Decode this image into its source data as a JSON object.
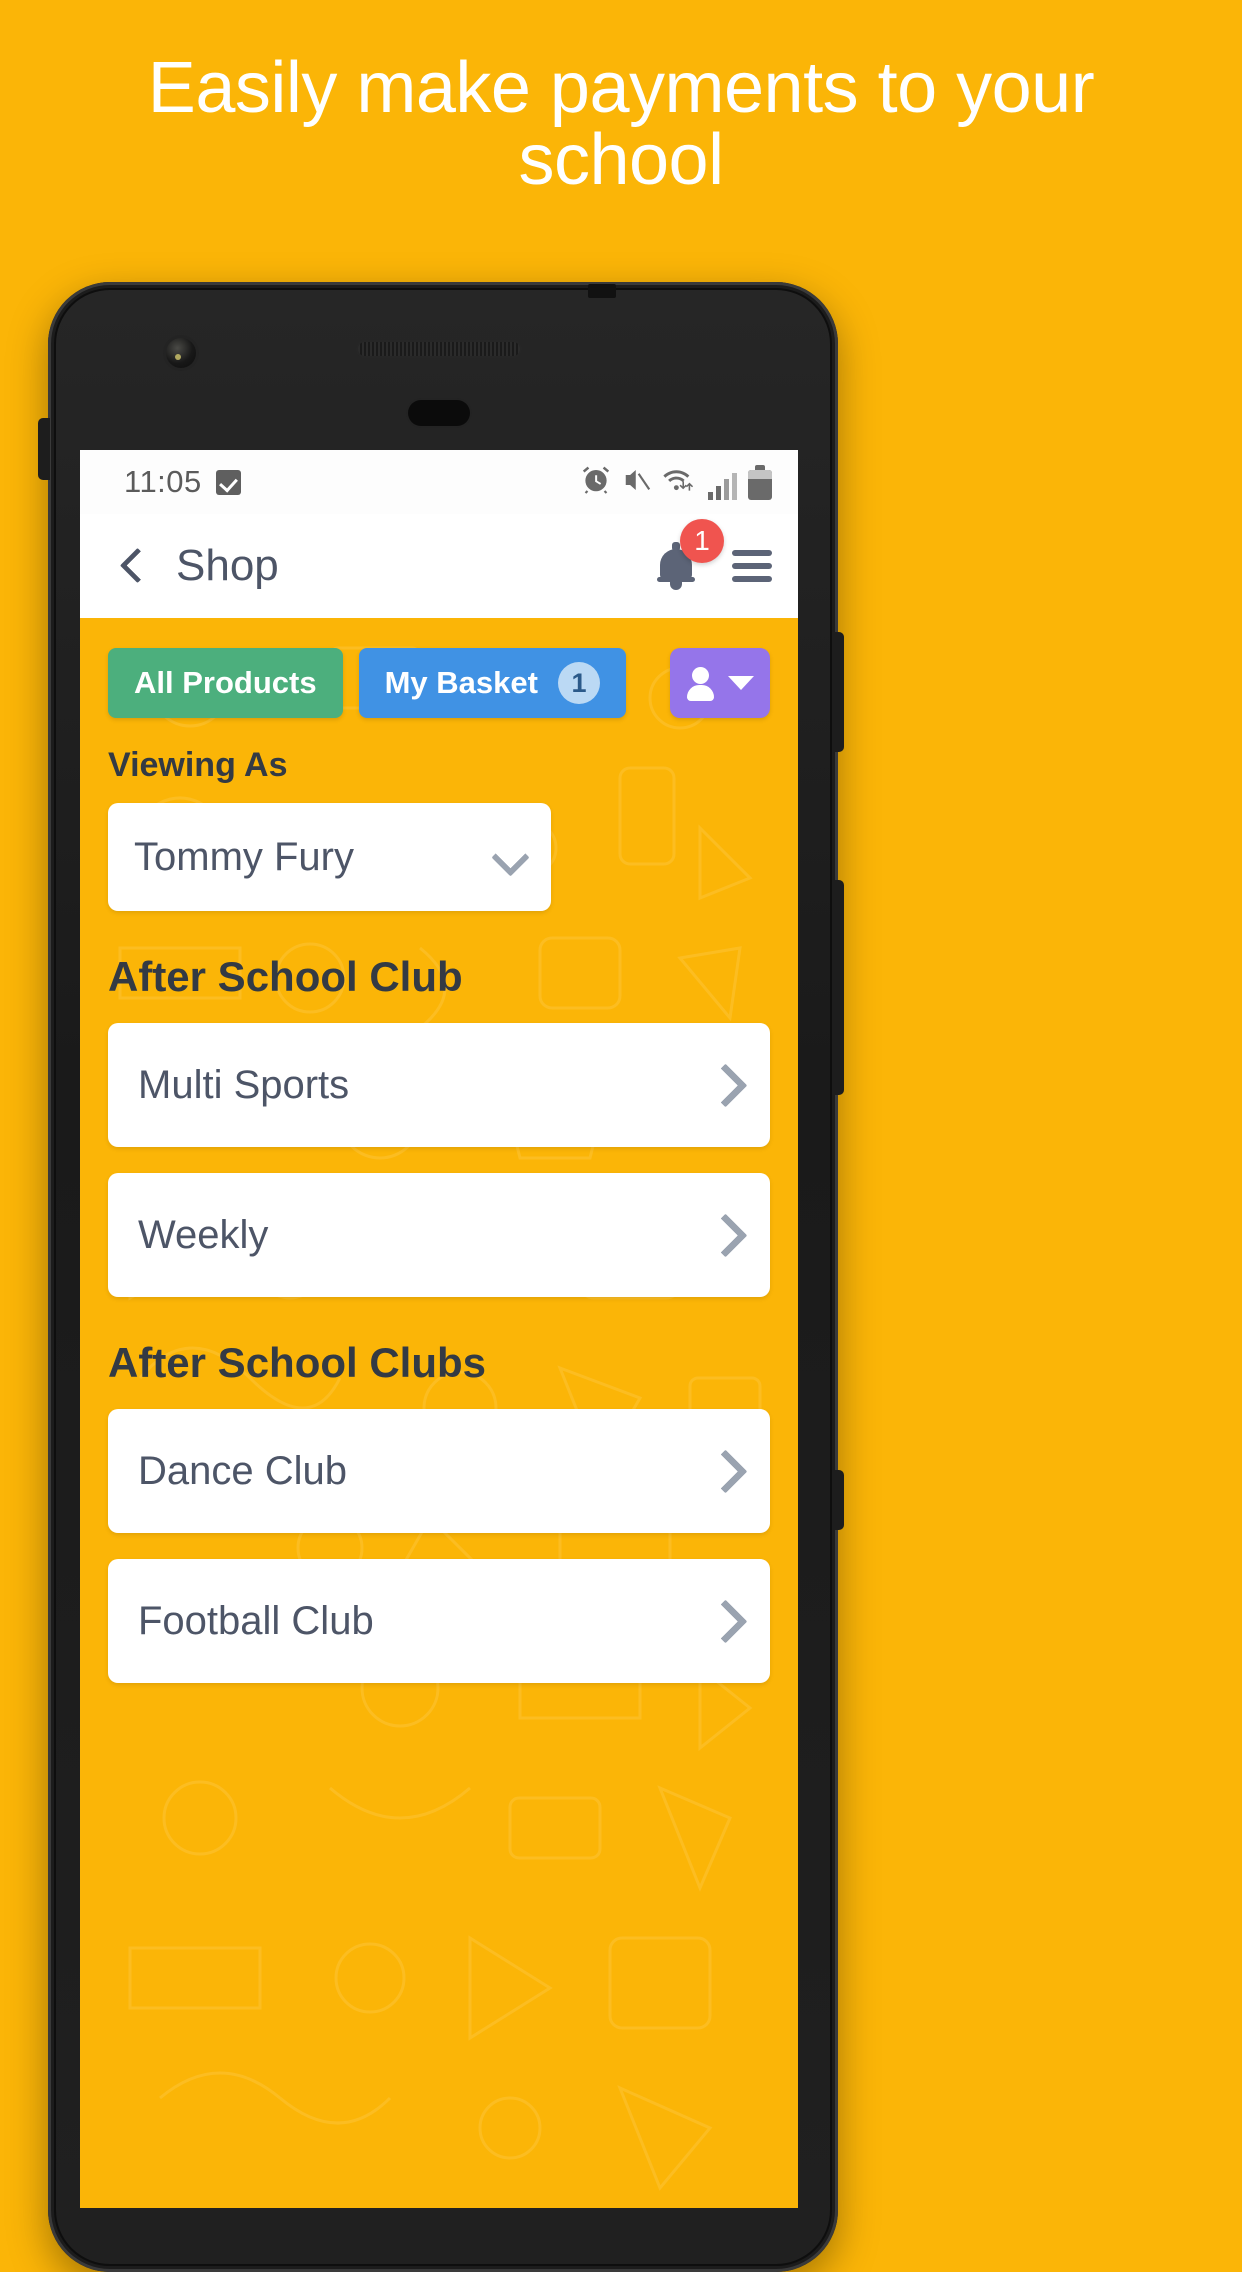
{
  "promo": {
    "headline": "Easily make payments to your school"
  },
  "colors": {
    "background": "#FBB507",
    "accent_green": "#4CAF7D",
    "accent_blue": "#4092E4",
    "accent_purple": "#9575EA",
    "badge_red": "#F0544F",
    "text_dark": "#333A44",
    "text_muted": "#4D5567"
  },
  "status_bar": {
    "time": "11:05",
    "icons": [
      "checkbox-icon",
      "alarm-clock-icon",
      "volume-mute-icon",
      "wifi-icon",
      "signal-bars-icon",
      "battery-icon"
    ]
  },
  "app_bar": {
    "back_icon": "chevron-left-icon",
    "title": "Shop",
    "notification_icon": "bell-icon",
    "notification_count": "1",
    "menu_icon": "hamburger-menu-icon"
  },
  "tabs": [
    {
      "label": "All Products",
      "badge": null
    },
    {
      "label": "My Basket",
      "badge": "1"
    }
  ],
  "user_button": {
    "icon": "person-icon",
    "caret": "caret-down-icon"
  },
  "viewing_as": {
    "label": "Viewing As",
    "selected": "Tommy Fury",
    "chevron": "chevron-down-icon"
  },
  "sections": [
    {
      "title": "After School Club",
      "items": [
        {
          "label": "Multi Sports",
          "chevron": "chevron-right-icon"
        },
        {
          "label": "Weekly",
          "chevron": "chevron-right-icon"
        }
      ]
    },
    {
      "title": "After School Clubs",
      "items": [
        {
          "label": "Dance Club",
          "chevron": "chevron-right-icon"
        },
        {
          "label": "Football Club",
          "chevron": "chevron-right-icon"
        }
      ]
    }
  ]
}
